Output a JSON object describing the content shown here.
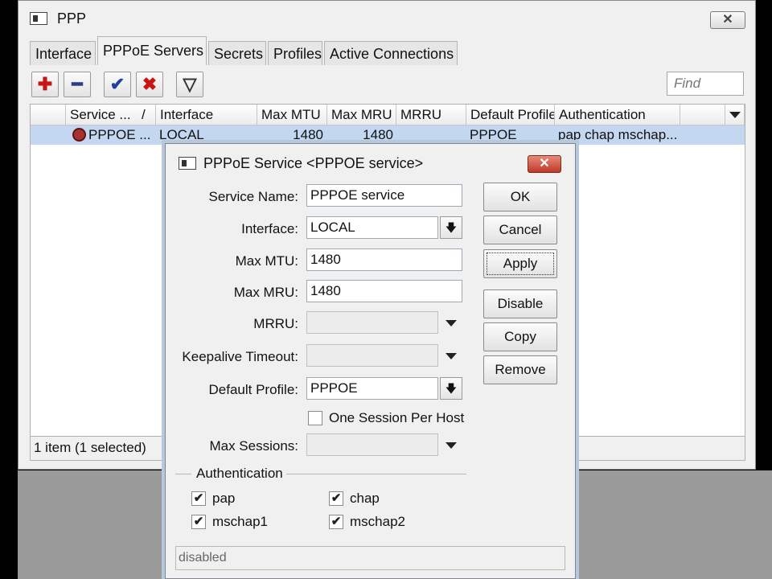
{
  "window": {
    "title": "PPP"
  },
  "tabs": [
    {
      "label": "Interface"
    },
    {
      "label": "PPPoE Servers"
    },
    {
      "label": "Secrets"
    },
    {
      "label": "Profiles"
    },
    {
      "label": "Active Connections"
    }
  ],
  "toolbar": {
    "add_symbol": "✚",
    "remove_symbol": "━",
    "enable_symbol": "✔",
    "disable_symbol": "✖",
    "filter_symbol": "▽",
    "find_placeholder": "Find",
    "accent_add": "#c81414",
    "accent_enable": "#2040a0"
  },
  "table": {
    "columns": [
      "Service ...",
      "/",
      "Interface",
      "Max MTU",
      "Max MRU",
      "MRRU",
      "Default Profile",
      "Authentication"
    ],
    "rows": [
      {
        "service": "PPPOE ...",
        "interface": "LOCAL",
        "max_mtu": "1480",
        "max_mru": "1480",
        "mrru": "",
        "default_profile": "PPPOE",
        "authentication": "pap chap mschap..."
      }
    ],
    "selected_row_color": "#c3d7f0"
  },
  "status": "1 item (1 selected)",
  "dialog": {
    "title": "PPPoE Service <PPPOE service>",
    "fields": {
      "service_name": {
        "label": "Service Name:",
        "value": "PPPOE service"
      },
      "interface": {
        "label": "Interface:",
        "value": "LOCAL"
      },
      "max_mtu": {
        "label": "Max MTU:",
        "value": "1480"
      },
      "max_mru": {
        "label": "Max MRU:",
        "value": "1480"
      },
      "mrru": {
        "label": "MRRU:",
        "value": ""
      },
      "keepalive": {
        "label": "Keepalive Timeout:",
        "value": ""
      },
      "default_profile": {
        "label": "Default Profile:",
        "value": "PPPOE"
      },
      "one_session": {
        "label": "One Session Per Host",
        "checked": false
      },
      "max_sessions": {
        "label": "Max Sessions:",
        "value": ""
      }
    },
    "authentication": {
      "legend": "Authentication",
      "options": [
        {
          "label": "pap",
          "checked": true
        },
        {
          "label": "chap",
          "checked": true
        },
        {
          "label": "mschap1",
          "checked": true
        },
        {
          "label": "mschap2",
          "checked": true
        }
      ]
    },
    "buttons": {
      "ok": "OK",
      "cancel": "Cancel",
      "apply": "Apply",
      "disable": "Disable",
      "copy": "Copy",
      "remove": "Remove"
    },
    "status": "disabled",
    "check_mark": "✔",
    "close_glyph": "✕",
    "close_color": "#c0392b"
  },
  "window_close_glyph": "✕"
}
